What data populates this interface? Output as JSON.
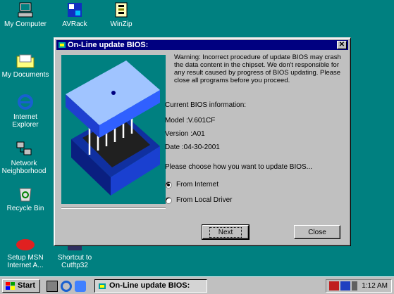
{
  "desktop": {
    "icons": [
      {
        "name": "my-computer",
        "label": "My Computer"
      },
      {
        "name": "avrack",
        "label": "AVRack"
      },
      {
        "name": "winzip",
        "label": "WinZip"
      },
      {
        "name": "my-documents",
        "label": "My Documents"
      },
      {
        "name": "internet-explorer",
        "label": "Internet\nExplorer"
      },
      {
        "name": "network-neighborhood",
        "label": "Network\nNeighborhood"
      },
      {
        "name": "recycle-bin",
        "label": "Recycle Bin"
      },
      {
        "name": "setup-msn",
        "label": "Setup MSN\nInternet A..."
      },
      {
        "name": "cutftp32",
        "label": "Shortcut to\nCutftp32"
      }
    ]
  },
  "dialog": {
    "title": "On-Line update BIOS:",
    "close_glyph": "✕",
    "warning": "Warning: Incorrect procedure of update BIOS may crash the data content in the chipset. We don't responsible for any result caused by progress of BIOS updating. Please close all programs before you proceed.",
    "info_header": "Current BIOS information:",
    "model": "Model :V.601CF",
    "version": "Version :A01",
    "date": "Date :04-30-2001",
    "prompt": "Please choose how you want to update BIOS...",
    "options": [
      {
        "label": "From Internet",
        "selected": true
      },
      {
        "label": "From Local Driver",
        "selected": false
      }
    ],
    "next_label": "Next",
    "close_label": "Close"
  },
  "taskbar": {
    "start_label": "Start",
    "task_label": "On-Line update BIOS:",
    "clock": "1:12 AM"
  },
  "colors": {
    "desktop": "#008080",
    "titlebar": "#000080",
    "chip_blue": "#1f3fd0"
  }
}
